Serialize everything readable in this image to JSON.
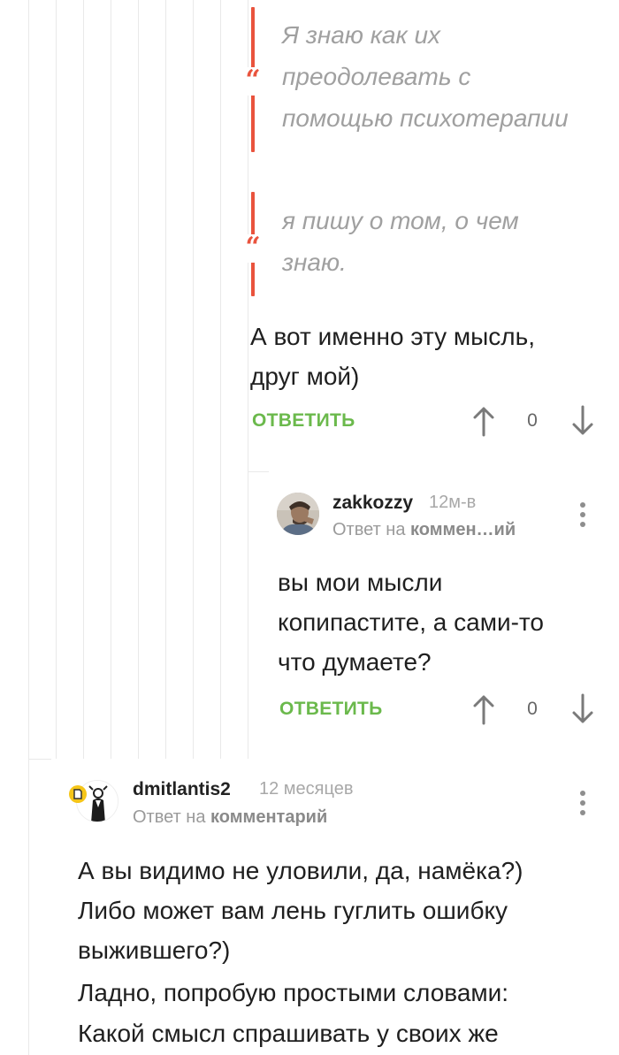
{
  "thread": {
    "quotes": [
      {
        "lines": [
          "Я знаю как их",
          "преодолевать с",
          "помощью психотерапии"
        ]
      },
      {
        "lines": [
          " я пишу о том, о чем",
          "знаю."
        ]
      }
    ],
    "quote_mark": "“"
  },
  "comment1": {
    "body_lines": [
      "А вот именно эту мысль,",
      "друг мой)"
    ],
    "reply_label": "ОТВЕТИТЬ",
    "score": "0"
  },
  "comment2": {
    "author": "zakkozzy",
    "time": "12м-в",
    "reply_to_prefix": "Ответ на",
    "reply_to_target": "коммен…ий",
    "body_lines": [
      "вы мои мысли",
      "копипастите, а сами-то",
      "что думаете?"
    ],
    "reply_label": "ОТВЕТИТЬ",
    "score": "0"
  },
  "comment3": {
    "author": "dmitlantis2",
    "time": "12 месяцев",
    "reply_to_prefix": "Ответ на",
    "reply_to_target": "комментарий",
    "body_lines": [
      "А вы видимо не уловили, да, намёка?)",
      "Либо может вам лень гуглить ошибку",
      "выжившего?)",
      "Ладно, попробую простыми словами:",
      "Какой смысл спрашивать у своих же"
    ]
  },
  "colors": {
    "accent_green": "#6bb94c",
    "quote_red": "#e9533d",
    "badge_yellow": "#f5c518"
  },
  "icons": {
    "upvote": "arrow-up-icon",
    "downvote": "arrow-down-icon",
    "more": "more-vertical-icon",
    "badge": "document-badge-icon"
  }
}
